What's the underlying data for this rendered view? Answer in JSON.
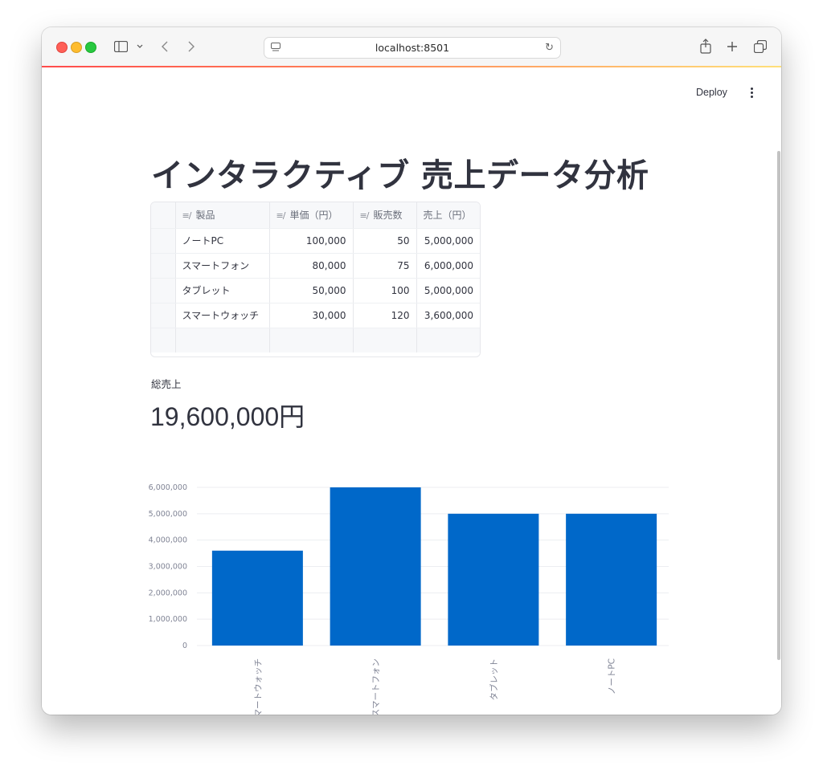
{
  "browser": {
    "url": "localhost:8501"
  },
  "header": {
    "deploy_label": "Deploy"
  },
  "page": {
    "title": "インタラクティブ 売上データ分析"
  },
  "table": {
    "columns": [
      "製品",
      "単価（円）",
      "販売数",
      "売上（円）"
    ],
    "rows": [
      [
        "ノートPC",
        "100,000",
        "50",
        "5,000,000"
      ],
      [
        "スマートフォン",
        "80,000",
        "75",
        "6,000,000"
      ],
      [
        "タブレット",
        "50,000",
        "100",
        "5,000,000"
      ],
      [
        "スマートウォッチ",
        "30,000",
        "120",
        "3,600,000"
      ]
    ]
  },
  "metric": {
    "label": "総売上",
    "value": "19,600,000円"
  },
  "chart_data": {
    "type": "bar",
    "categories": [
      "スマートウォッチ",
      "スマートフォン",
      "タブレット",
      "ノートPC"
    ],
    "values": [
      3600000,
      6000000,
      5000000,
      5000000
    ],
    "title": "",
    "xlabel": "",
    "ylabel": "",
    "ylim": [
      0,
      6000000
    ],
    "yticks": [
      0,
      1000000,
      2000000,
      3000000,
      4000000,
      5000000,
      6000000
    ],
    "ytick_labels": [
      "0",
      "1,000,000",
      "2,000,000",
      "3,000,000",
      "4,000,000",
      "5,000,000",
      "6,000,000"
    ],
    "bar_color": "#0068c9",
    "grid": true
  }
}
